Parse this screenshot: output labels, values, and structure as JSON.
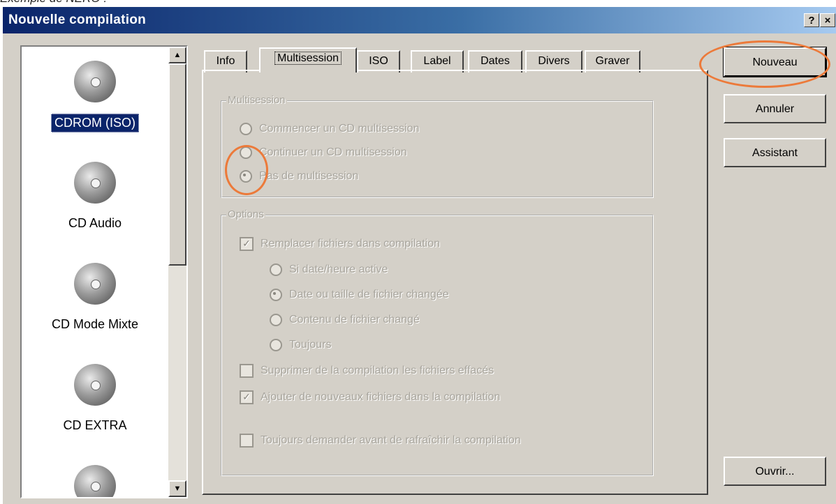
{
  "caption": "Exemple de NERO :",
  "window": {
    "title": "Nouvelle compilation",
    "help_label": "?",
    "close_label": "×"
  },
  "sidebar": {
    "items": [
      {
        "label": "CDROM (ISO)",
        "icon": "cd-rom-icon",
        "selected": true
      },
      {
        "label": "CD Audio",
        "icon": "cd-audio-icon",
        "selected": false
      },
      {
        "label": "CD Mode Mixte",
        "icon": "cd-mixed-icon",
        "selected": false
      },
      {
        "label": "CD EXTRA",
        "icon": "cd-extra-icon",
        "selected": false
      },
      {
        "label": "",
        "icon": "cd-icon",
        "selected": false
      }
    ]
  },
  "tabs": [
    "Info",
    "Multisession",
    "ISO",
    "Label",
    "Dates",
    "Divers",
    "Graver"
  ],
  "active_tab": "Multisession",
  "multisession_group": {
    "legend": "Multisession",
    "options": [
      "Commencer un CD multisession",
      "Continuer un CD multisession",
      "Pas de multisession"
    ],
    "selected_index": 2
  },
  "options_group": {
    "legend": "Options",
    "replace_files": {
      "label": "Remplacer fichiers dans compilation",
      "checked": true
    },
    "sub_options": [
      "Si date/heure active",
      "Date ou taille de fichier changée",
      "Contenu de fichier changé",
      "Toujours"
    ],
    "sub_selected_index": 1,
    "remove_deleted": {
      "label": "Supprimer de la compilation les fichiers effacés",
      "checked": false
    },
    "add_new": {
      "label": "Ajouter de nouveaux fichiers dans la compilation",
      "checked": true
    },
    "always_ask": {
      "label": "Toujours demander avant de rafraîchir la compilation",
      "checked": false
    }
  },
  "buttons": {
    "new": "Nouveau",
    "cancel": "Annuler",
    "wizard": "Assistant",
    "open": "Ouvrir..."
  },
  "colors": {
    "highlight_ring": "#ec7a3a",
    "title_bar": "#0a246a",
    "dialog_bg": "#d4d0c8"
  }
}
